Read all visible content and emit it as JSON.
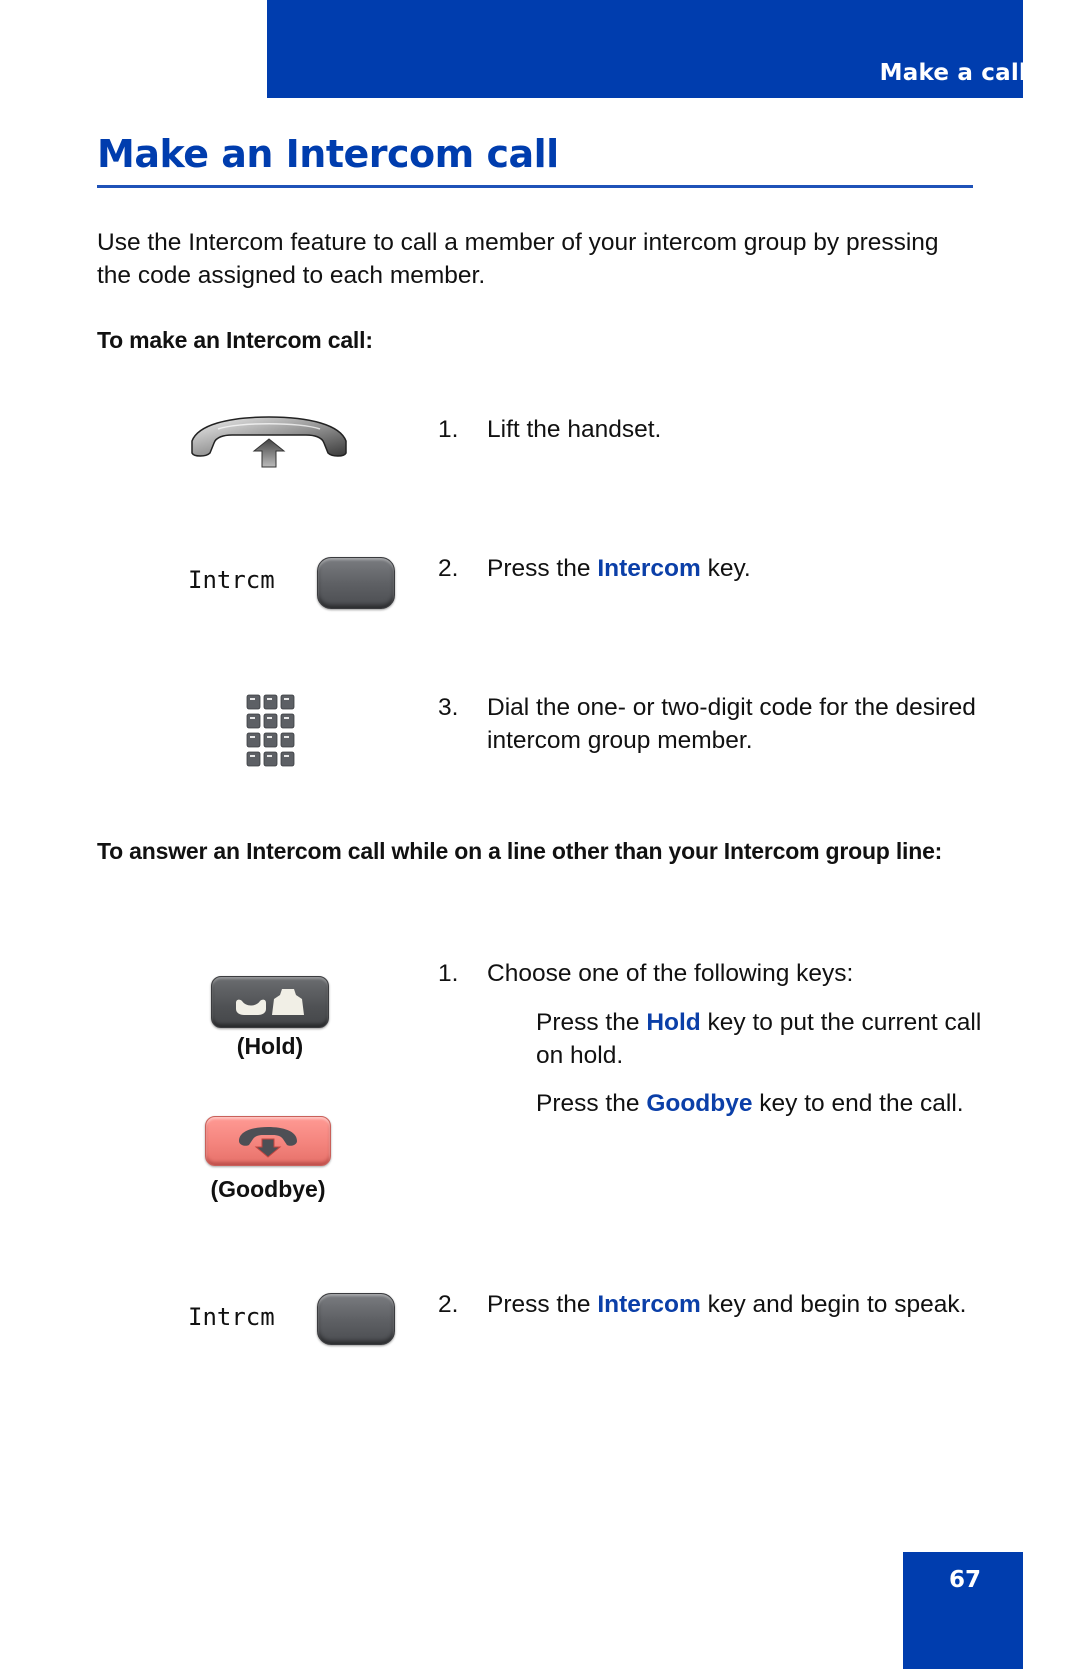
{
  "header": {
    "section_label": "Make a call"
  },
  "title": "Make an Intercom call",
  "intro": "Use the Intercom feature to call a member of your intercom group by pressing the code assigned to each member.",
  "make_call": {
    "heading": "To make an Intercom call:",
    "steps": [
      {
        "num": "1.",
        "icon": "handset-lift-icon",
        "text": "Lift the handset."
      },
      {
        "num": "2.",
        "icon": "intercom-key",
        "lcd_label": "Intrcm",
        "pre": "Press the ",
        "keyword": "Intercom",
        "post": " key."
      },
      {
        "num": "3.",
        "icon": "dialpad-icon",
        "text": "Dial the one- or two-digit code for the desired intercom group member."
      }
    ]
  },
  "answer_call": {
    "heading": "To answer an Intercom call while on a line other than your Intercom group line:",
    "steps": [
      {
        "num": "1.",
        "text": "Choose one of the following keys:",
        "options": [
          {
            "key_caption": "(Hold)",
            "pre": "Press the ",
            "keyword": "Hold",
            "post": " key to put the current call on hold."
          },
          {
            "key_caption": "(Goodbye)",
            "pre": "Press the ",
            "keyword": "Goodbye",
            "post": " key to end the call."
          }
        ]
      },
      {
        "num": "2.",
        "lcd_label": "Intrcm",
        "pre": "Press the ",
        "keyword": "Intercom",
        "post": " key and begin to speak."
      }
    ]
  },
  "footer": {
    "page_number": "67"
  },
  "colors": {
    "brand_blue": "#003DAE",
    "keyword_blue": "#0B3FA8",
    "goodbye_key": "#F4847D",
    "dark_key": "#5F6165"
  }
}
